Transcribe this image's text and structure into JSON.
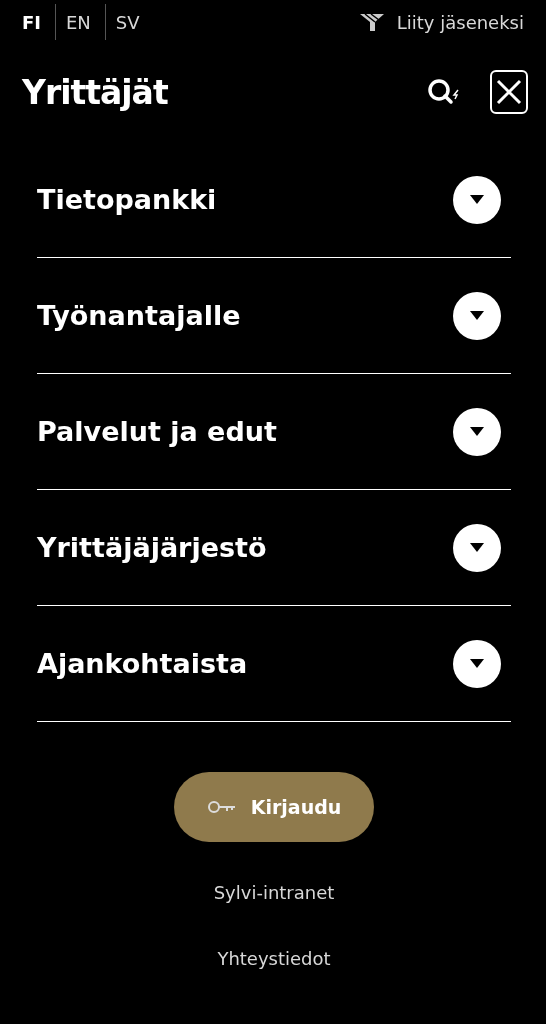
{
  "languages": [
    {
      "label": "FI",
      "selected": true
    },
    {
      "label": "EN",
      "selected": false
    },
    {
      "label": "SV",
      "selected": false
    }
  ],
  "join_link": "Liity jäseneksi",
  "logo": "Yrittäjät",
  "menu": [
    {
      "label": "Tietopankki",
      "expanded": false
    },
    {
      "label": "Työnantajalle",
      "expanded": false
    },
    {
      "label": "Palvelut ja edut",
      "expanded": false
    },
    {
      "label": "Yrittäjäjärjestö",
      "expanded": false
    },
    {
      "label": "Ajankohtaista",
      "expanded": false
    }
  ],
  "login_button": "Kirjaudu",
  "footer_links": [
    "Sylvi-intranet",
    "Yhteystiedot"
  ]
}
